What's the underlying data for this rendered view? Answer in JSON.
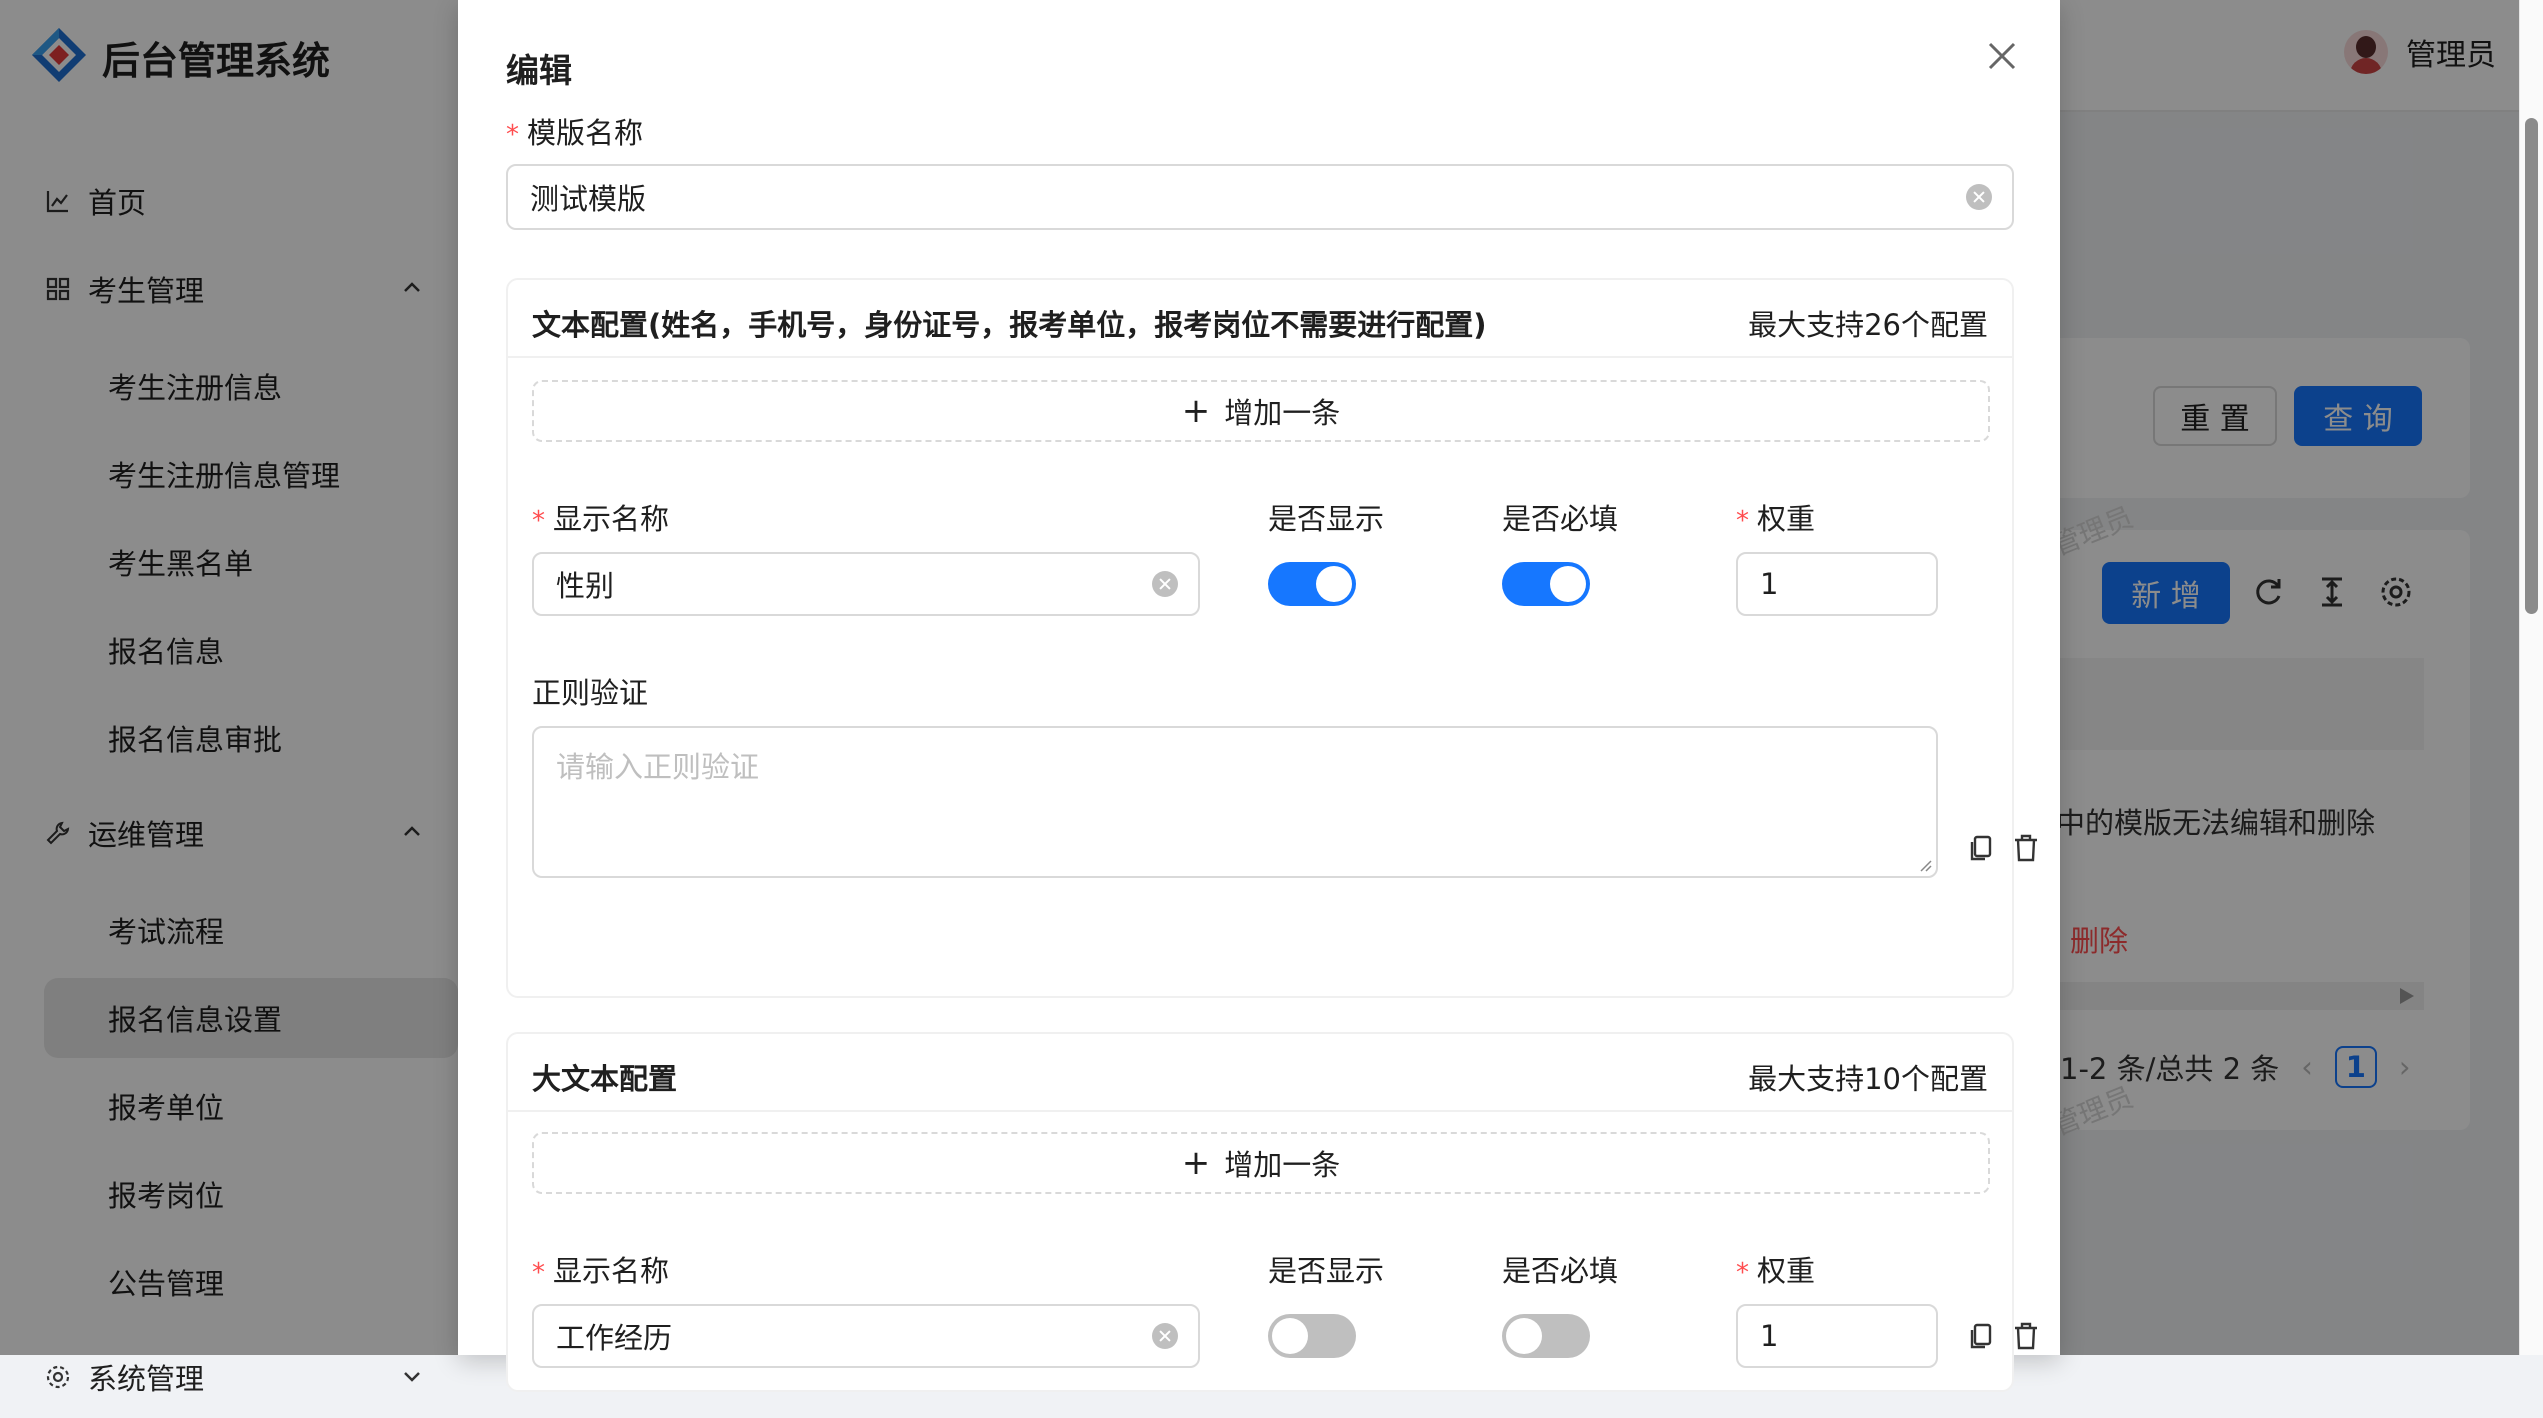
{
  "app": {
    "title": "后台管理系统",
    "user_name": "管理员"
  },
  "sidebar": {
    "items": [
      {
        "label": "首页",
        "icon": "line-chart-icon"
      },
      {
        "label": "考生管理",
        "icon": "appstore-icon"
      },
      {
        "label": "考生注册信息"
      },
      {
        "label": "考生注册信息管理"
      },
      {
        "label": "考生黑名单"
      },
      {
        "label": "报名信息"
      },
      {
        "label": "报名信息审批"
      },
      {
        "label": "运维管理",
        "icon": "tool-icon"
      },
      {
        "label": "考试流程"
      },
      {
        "label": "报名信息设置",
        "active": true
      },
      {
        "label": "报考单位"
      },
      {
        "label": "报考岗位"
      },
      {
        "label": "公告管理"
      },
      {
        "label": "系统管理",
        "icon": "setting-icon"
      }
    ]
  },
  "background": {
    "reset_label": "重 置",
    "query_label": "查 询",
    "new_label": "新 增",
    "row_text": "中的模版无法编辑和删除",
    "delete_label": "删除",
    "pagination_text": "1-2 条/总共 2 条",
    "current_page": "1",
    "watermark": "管理员"
  },
  "modal": {
    "title": "编辑",
    "template_name_label": "模版名称",
    "template_name_value": "测试模版",
    "text_config": {
      "title": "文本配置(姓名，手机号，身份证号，报考单位，报考岗位不需要进行配置)",
      "extra": "最大支持26个配置",
      "add_label": "增加一条",
      "display_name_label": "显示名称",
      "display_name_value": "性别",
      "show_label": "是否显示",
      "show_on": true,
      "required_label": "是否必填",
      "required_on": true,
      "weight_label": "权重",
      "weight_value": "1",
      "regex_label": "正则验证",
      "regex_placeholder": "请输入正则验证"
    },
    "large_text_config": {
      "title": "大文本配置",
      "extra": "最大支持10个配置",
      "add_label": "增加一条",
      "display_name_label": "显示名称",
      "display_name_value": "工作经历",
      "show_label": "是否显示",
      "show_on": false,
      "required_label": "是否必填",
      "required_on": false,
      "weight_label": "权重",
      "weight_value": "1"
    }
  },
  "colors": {
    "primary": "#1677ff",
    "danger": "#ff4d4f",
    "mask": "rgba(0,0,0,0.45)"
  }
}
